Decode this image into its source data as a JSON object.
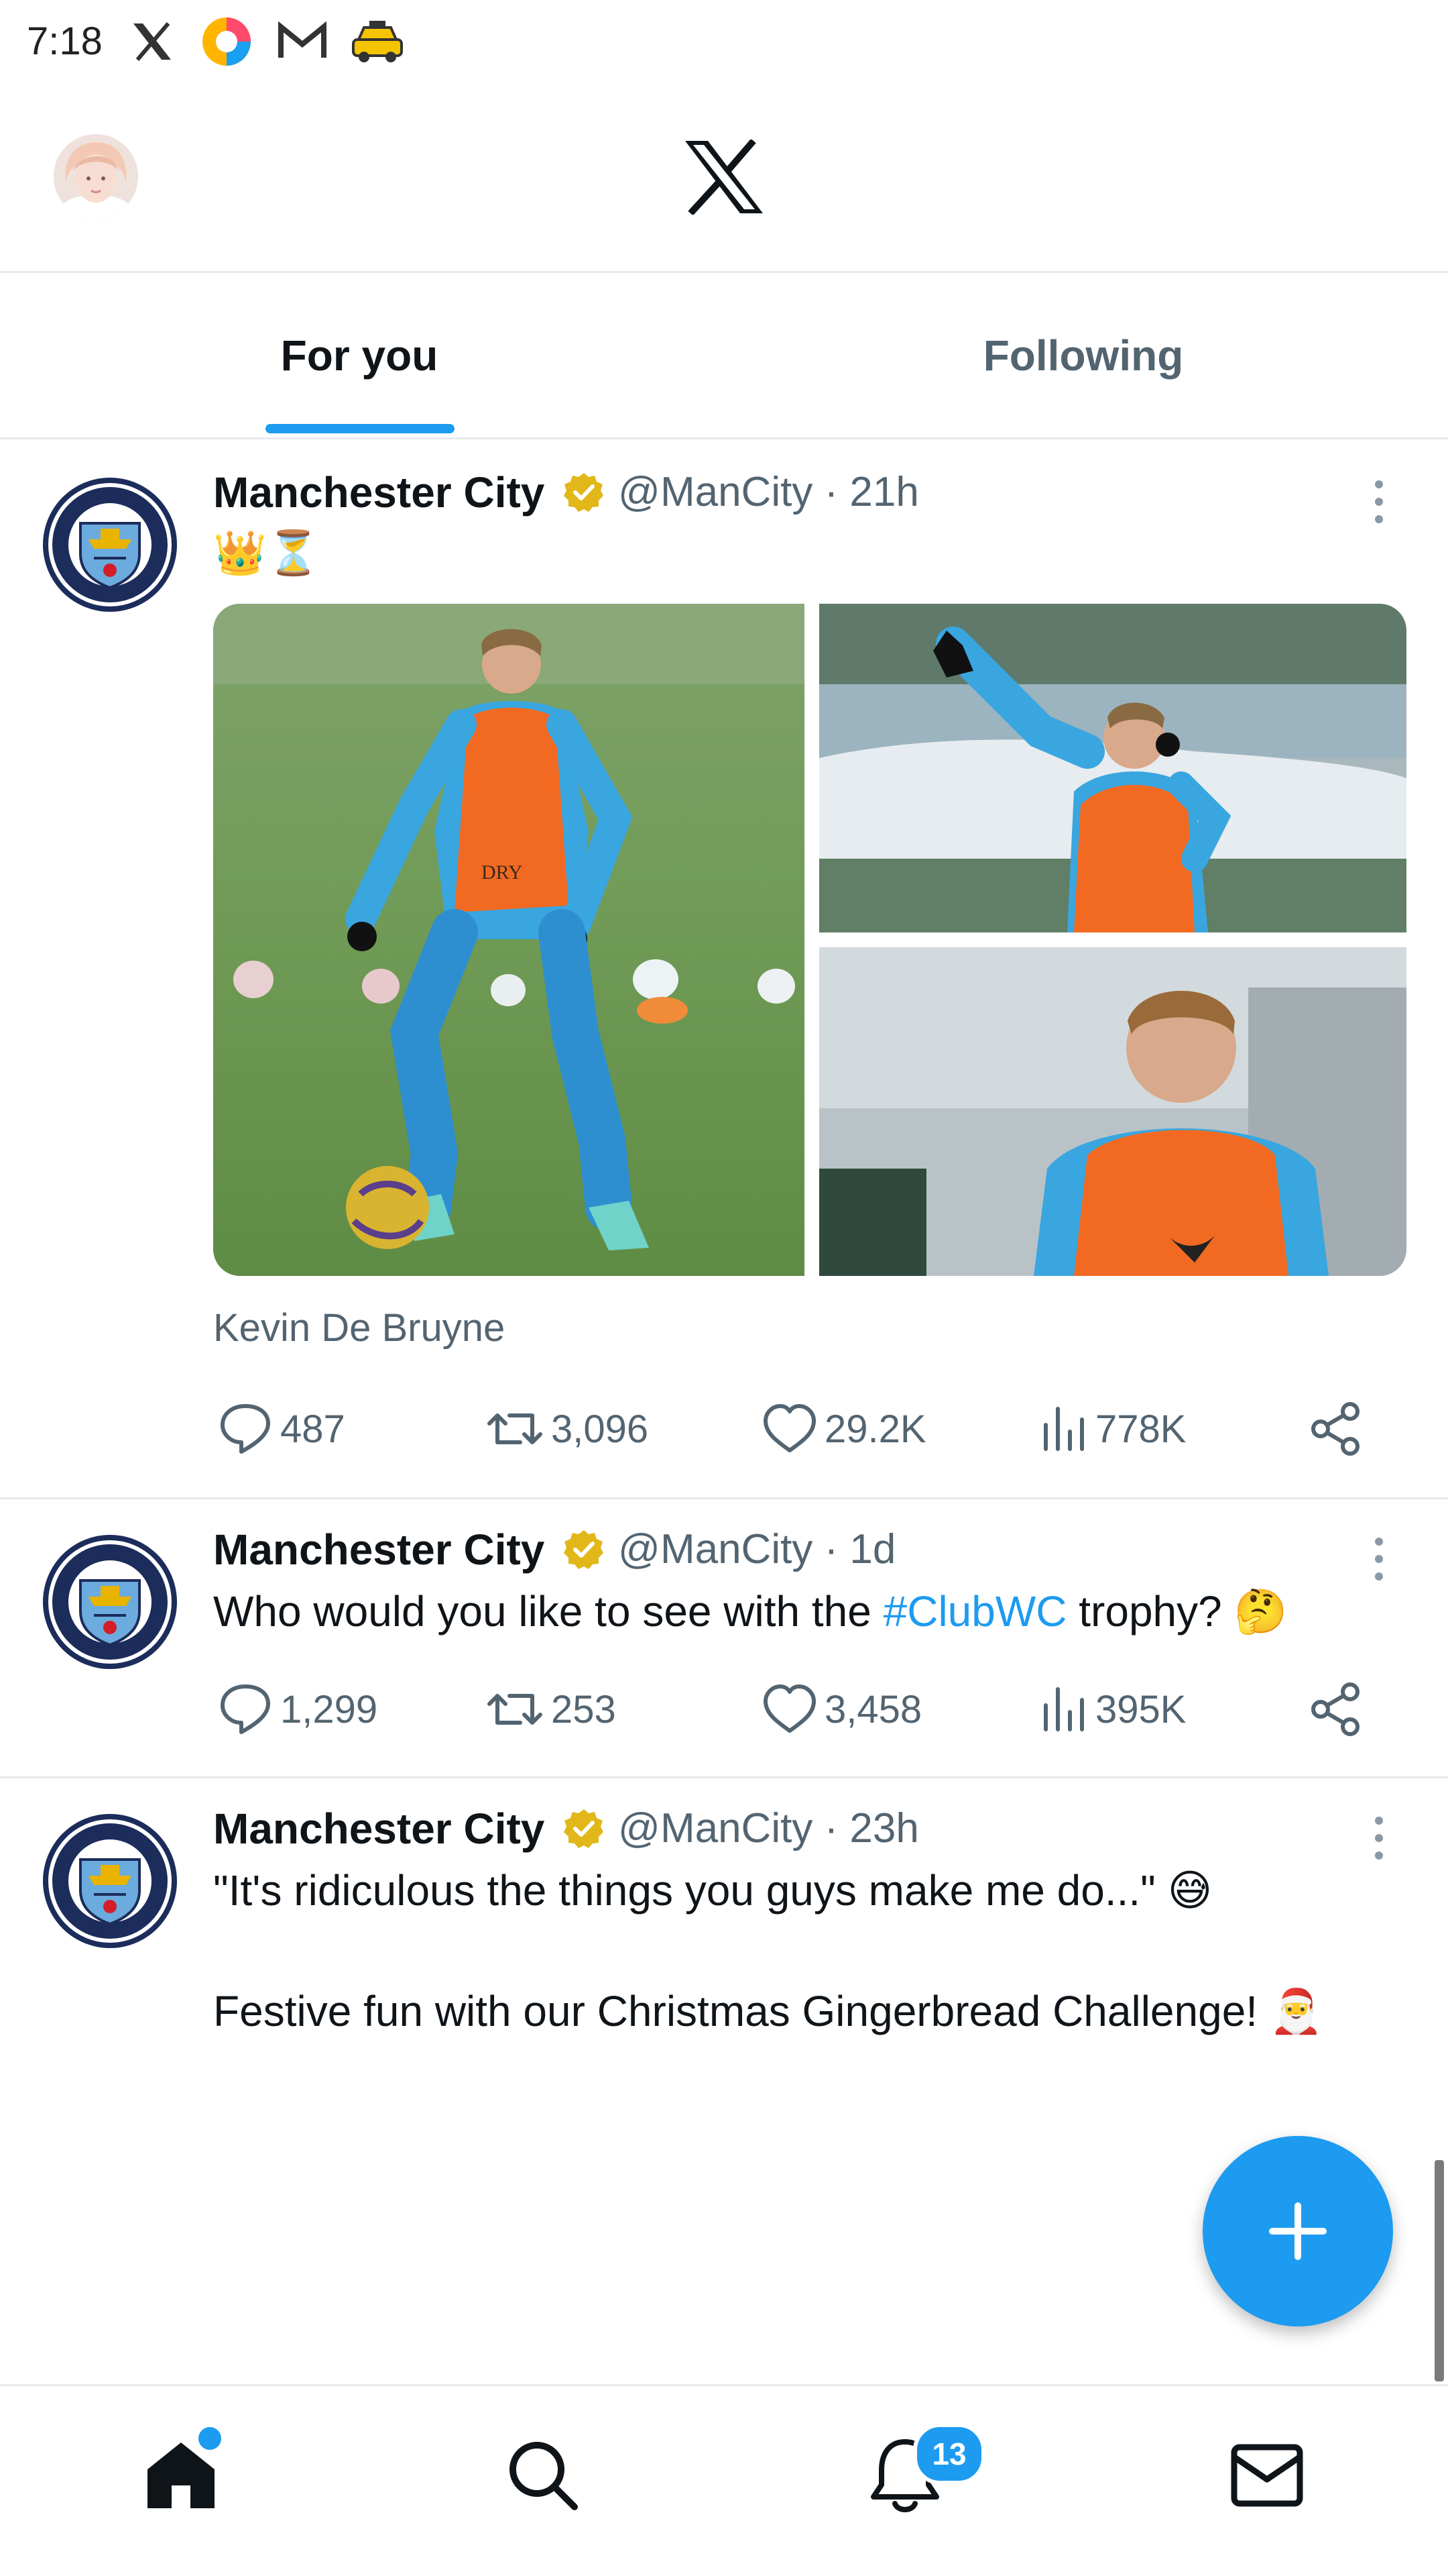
{
  "status_bar": {
    "time": "7:18",
    "icons": [
      "x-icon",
      "browser-icon",
      "mail-icon",
      "taxi-icon"
    ]
  },
  "header": {
    "logo": "x-logo-icon",
    "avatar": "profile-avatar"
  },
  "tabs": [
    {
      "label": "For you",
      "active": true
    },
    {
      "label": "Following",
      "active": false
    }
  ],
  "tweets": [
    {
      "author": "Manchester City",
      "handle": "@ManCity",
      "time": "· 21h",
      "text": "👑⏳",
      "caption": "Kevin De Bruyne",
      "replies": "487",
      "retweets": "3,096",
      "likes": "29.2K",
      "views": "778K"
    },
    {
      "author": "Manchester City",
      "handle": "@ManCity",
      "time": "· 1d",
      "text_before": "Who would you like to see with the ",
      "hashtag": "#ClubWC",
      "text_after": " trophy? 🤔",
      "replies": "1,299",
      "retweets": "253",
      "likes": "3,458",
      "views": "395K"
    },
    {
      "author": "Manchester City",
      "handle": "@ManCity",
      "time": "· 23h",
      "text_line1": "\"It's ridiculous the things you guys make me do...\" 😅",
      "text_line2": "Festive fun with our Christmas Gingerbread Challenge! 🎅"
    }
  ],
  "bottom_nav": {
    "items": [
      "home-icon",
      "search-icon",
      "notifications-icon",
      "messages-icon"
    ],
    "notification_count": "13"
  },
  "colors": {
    "accent": "#1d9bf0",
    "text_primary": "#0f1419",
    "text_secondary": "#536471",
    "verified_gold": "#e2b719",
    "bib_orange": "#f26a21",
    "kit_blue": "#3aa6e0"
  }
}
